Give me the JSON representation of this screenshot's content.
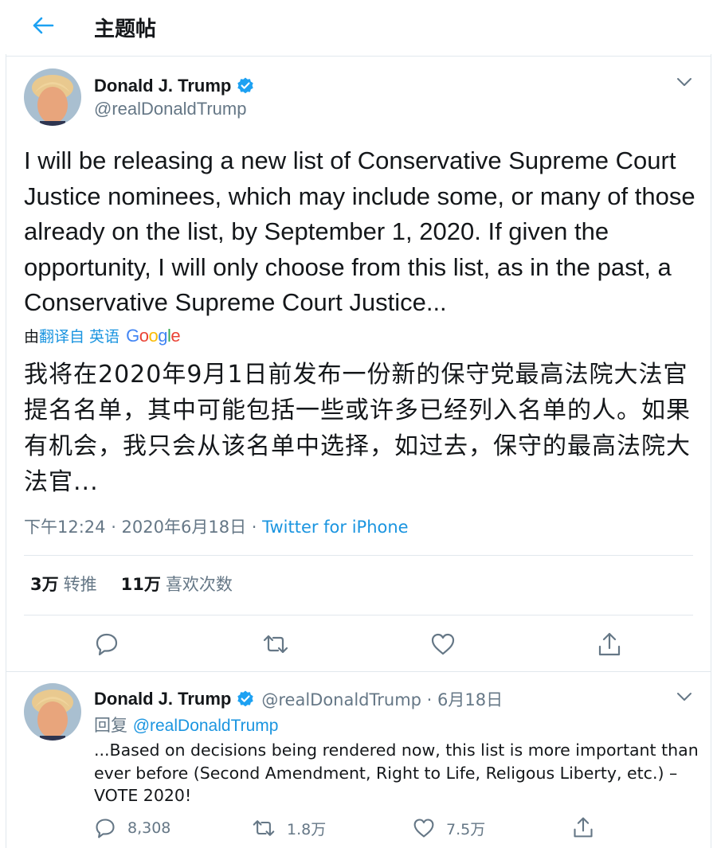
{
  "header": {
    "title": "主题帖"
  },
  "main_tweet": {
    "author_name": "Donald J. Trump",
    "handle": "@realDonaldTrump",
    "text": "I will be releasing a new list of Conservative Supreme Court Justice nominees, which may include some, or many of those already on the list, by September 1, 2020. If given the opportunity, I will only choose from this list, as in the past, a Conservative Supreme Court Justice...",
    "translation": {
      "prefix": "由",
      "link_text": "翻译自 英语",
      "provider": "Google",
      "text": "我将在2020年9月1日前发布一份新的保守党最高法院大法官提名名单，其中可能包括一些或许多已经列入名单的人。如果有机会，我只会从该名单中选择，如过去，保守的最高法院大法官..."
    },
    "timestamp": "下午12:24 · 2020年6月18日 · ",
    "source": "Twitter for iPhone",
    "stats": {
      "retweets_value": "3万",
      "retweets_label": "转推",
      "likes_value": "11万",
      "likes_label": "喜欢次数"
    }
  },
  "reply_tweet": {
    "author_name": "Donald J. Trump",
    "handle_and_date": "@realDonaldTrump · 6月18日",
    "reply_label": "回复 ",
    "reply_to": "@realDonaldTrump",
    "text": "...Based on decisions being rendered now, this list is more important than ever before (Second Amendment, Right to Life, Religous Liberty, etc.) – VOTE 2020!",
    "reply_count": "8,308",
    "retweet_count": "1.8万",
    "like_count": "7.5万"
  },
  "icons": {
    "back": "arrow-left-icon",
    "verified": "verified-badge-icon",
    "more": "chevron-down-icon",
    "reply": "speech-bubble-icon",
    "retweet": "retweet-icon",
    "like": "heart-icon",
    "share": "share-icon"
  },
  "colors": {
    "accent": "#1da1f2",
    "link": "#1b95e0",
    "secondary_text": "#657786",
    "border": "#e1e8ed"
  }
}
